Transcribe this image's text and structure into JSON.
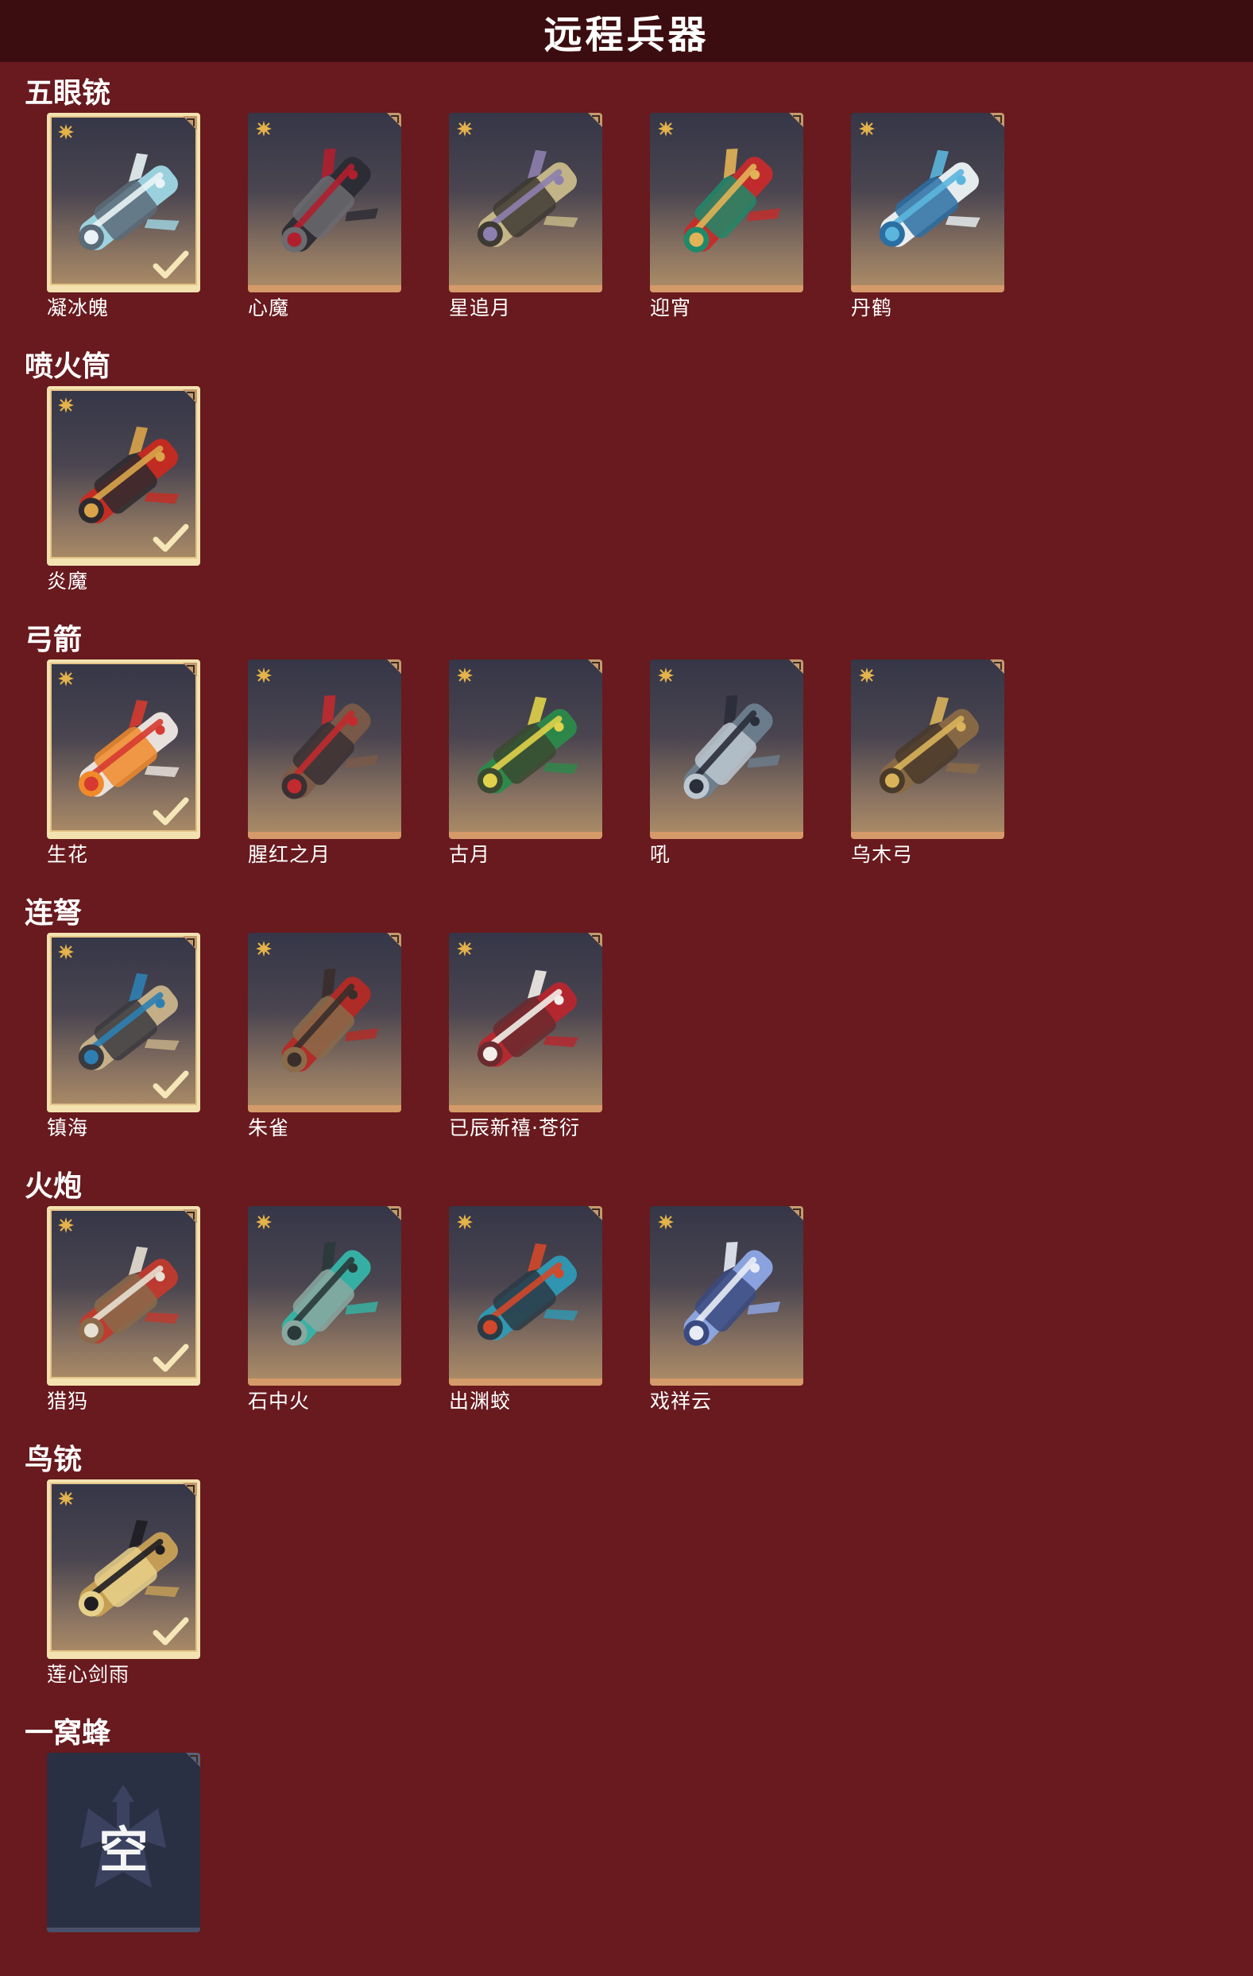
{
  "page": {
    "title": "远程兵器"
  },
  "colors": {
    "background": "#681a1e",
    "header": "#3c0d10",
    "tile_gold": "#d59a69",
    "selected_frame": "#f3e2b0",
    "empty_tile": "#2a3043"
  },
  "sections": [
    {
      "title": "五眼铳",
      "items": [
        {
          "name": "凝冰魄",
          "selected": true,
          "icon": "frost-cannon",
          "palette": [
            "#9fd8e6",
            "#e9f3f5",
            "#5a6b79"
          ]
        },
        {
          "name": "心魔",
          "selected": false,
          "icon": "demon-cannon",
          "palette": [
            "#2b2b33",
            "#b11f2d",
            "#6b6b70"
          ]
        },
        {
          "name": "星追月",
          "selected": false,
          "icon": "star-cannon",
          "palette": [
            "#c9bb8a",
            "#8d7fae",
            "#3d3a33"
          ]
        },
        {
          "name": "迎宵",
          "selected": false,
          "icon": "lion-cannon",
          "palette": [
            "#c72b2b",
            "#e2b256",
            "#1f8a6a"
          ]
        },
        {
          "name": "丹鹤",
          "selected": false,
          "icon": "crane-cannon",
          "palette": [
            "#eef5f7",
            "#5bb5dd",
            "#2a6fa3"
          ]
        }
      ]
    },
    {
      "title": "喷火筒",
      "items": [
        {
          "name": "炎魔",
          "selected": true,
          "icon": "flame-tube",
          "palette": [
            "#c82a20",
            "#d9a44a",
            "#2d2a2e"
          ]
        }
      ]
    },
    {
      "title": "弓箭",
      "items": [
        {
          "name": "生花",
          "selected": true,
          "icon": "blossom-bow",
          "palette": [
            "#f0e9e4",
            "#d63a30",
            "#f08a2a"
          ]
        },
        {
          "name": "腥红之月",
          "selected": false,
          "icon": "crimson-bow",
          "palette": [
            "#7b5a48",
            "#c22a2e",
            "#3a3034"
          ]
        },
        {
          "name": "古月",
          "selected": false,
          "icon": "ancient-bow",
          "palette": [
            "#2b8a4a",
            "#e0d24a",
            "#3a4a30"
          ]
        },
        {
          "name": "吼",
          "selected": false,
          "icon": "roar-bow",
          "palette": [
            "#6d7f8f",
            "#2a2e3a",
            "#bcc7d0"
          ]
        },
        {
          "name": "乌木弓",
          "selected": false,
          "icon": "ebony-bow",
          "palette": [
            "#8a6a45",
            "#d9b25a",
            "#4a3a2a"
          ]
        }
      ]
    },
    {
      "title": "连弩",
      "items": [
        {
          "name": "镇海",
          "selected": true,
          "icon": "sea-crossbow",
          "palette": [
            "#c9b48a",
            "#2d7fb3",
            "#3a3a3f"
          ]
        },
        {
          "name": "朱雀",
          "selected": false,
          "icon": "vermilion-crossbow",
          "palette": [
            "#b52a25",
            "#3a2e2b",
            "#8a6b4a"
          ]
        },
        {
          "name": "已辰新禧·苍衍",
          "selected": false,
          "icon": "dragon-crossbow",
          "palette": [
            "#b8262d",
            "#f2eee9",
            "#6b2a2e"
          ]
        }
      ]
    },
    {
      "title": "火炮",
      "items": [
        {
          "name": "猎犸",
          "selected": true,
          "icon": "hunter-cannon",
          "palette": [
            "#c23a2d",
            "#e8e0d2",
            "#8a6a4a"
          ]
        },
        {
          "name": "石中火",
          "selected": false,
          "icon": "stone-fire-cannon",
          "palette": [
            "#35b5a8",
            "#2a3a3a",
            "#8aa8a0"
          ]
        },
        {
          "name": "出渊蛟",
          "selected": false,
          "icon": "dragon-cannon",
          "palette": [
            "#2e9ab5",
            "#d2482a",
            "#2a3a45"
          ]
        },
        {
          "name": "戏祥云",
          "selected": false,
          "icon": "cloud-lance",
          "palette": [
            "#8ea8e6",
            "#e8ecf6",
            "#3a4a80"
          ]
        }
      ]
    },
    {
      "title": "鸟铳",
      "items": [
        {
          "name": "莲心剑雨",
          "selected": true,
          "icon": "lotus-musket",
          "palette": [
            "#c9a155",
            "#1e1d22",
            "#e7d08a"
          ]
        }
      ]
    },
    {
      "title": "一窝蜂",
      "items": [
        {
          "name": "",
          "selected": false,
          "empty": true,
          "empty_label": "空",
          "icon": "empty-slot"
        }
      ]
    }
  ]
}
